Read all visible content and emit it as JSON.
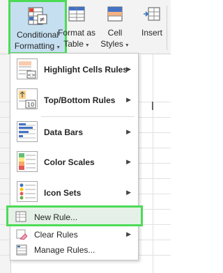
{
  "ribbon": {
    "conditional_formatting": {
      "line1": "Conditional",
      "line2": "Formatting",
      "icon": "conditional-formatting-icon"
    },
    "format_as_table": {
      "line1": "Format as",
      "line2": "Table"
    },
    "cell_styles": {
      "line1": "Cell",
      "line2": "Styles"
    },
    "insert": {
      "line1": "Insert"
    },
    "highlight_color": "#4cdb55"
  },
  "menu": {
    "items": [
      {
        "label": "Highlight Cells Rules",
        "icon": "highlight-cells-icon",
        "submenu": true
      },
      {
        "label": "Top/Bottom Rules",
        "icon": "top-bottom-icon",
        "submenu": true
      },
      {
        "label": "Data Bars",
        "icon": "data-bars-icon",
        "submenu": true
      },
      {
        "label": "Color Scales",
        "icon": "color-scales-icon",
        "submenu": true
      },
      {
        "label": "Icon Sets",
        "icon": "icon-sets-icon",
        "submenu": true
      }
    ],
    "new_rule": {
      "label": "New Rule...",
      "icon": "new-rule-icon"
    },
    "clear_rules": {
      "label": "Clear Rules",
      "icon": "clear-rules-icon",
      "submenu": true
    },
    "manage_rules": {
      "label": "Manage Rules...",
      "icon": "manage-rules-icon"
    }
  }
}
